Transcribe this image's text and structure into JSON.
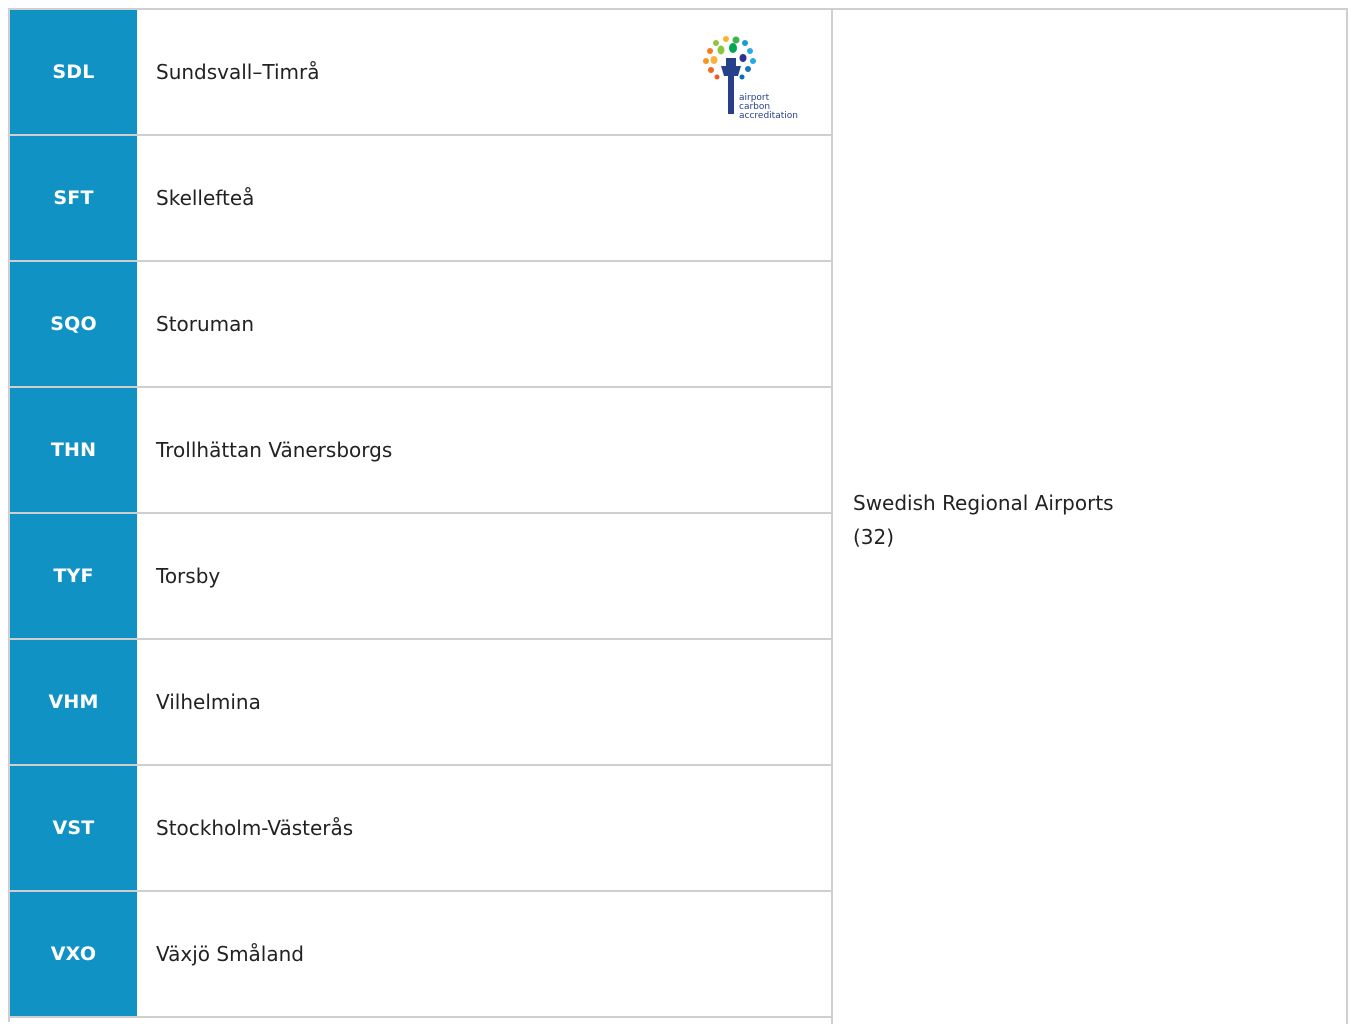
{
  "rows": [
    {
      "code": "SDL",
      "name": "Sundsvall–Timrå"
    },
    {
      "code": "SFT",
      "name": "Skellefteå"
    },
    {
      "code": "SQO",
      "name": "Storuman"
    },
    {
      "code": "THN",
      "name": "Trollhättan Vänersborgs"
    },
    {
      "code": "TYF",
      "name": "Torsby"
    },
    {
      "code": "VHM",
      "name": "Vilhelmina"
    },
    {
      "code": "VST",
      "name": "Stockholm-Västerås"
    },
    {
      "code": "VXO",
      "name": "Växjö Småland"
    }
  ],
  "group": {
    "name": "Swedish Regional Airports",
    "count": "(32)"
  },
  "logo": {
    "line1": "airport",
    "line2": "carbon",
    "line3": "accreditation"
  },
  "colors": {
    "code_bg": "#1192c4",
    "border": "#cfcfcf"
  }
}
